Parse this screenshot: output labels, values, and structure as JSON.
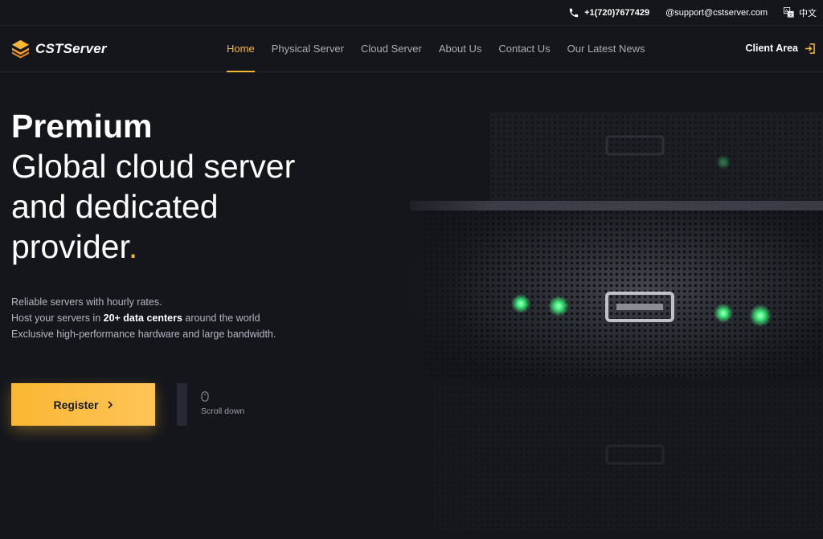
{
  "topbar": {
    "phone": "+1(720)7677429",
    "email": "@support@cstserver.com",
    "language": "中文"
  },
  "logo": {
    "text": "CSTServer"
  },
  "nav": {
    "items": [
      {
        "label": "Home"
      },
      {
        "label": "Physical Server"
      },
      {
        "label": "Cloud Server"
      },
      {
        "label": "About Us"
      },
      {
        "label": "Contact Us"
      },
      {
        "label": "Our Latest News"
      }
    ],
    "client_area": "Client Area"
  },
  "hero": {
    "premium": "Premium",
    "line1": "Global cloud server",
    "line2": "and dedicated",
    "line3": "provider",
    "dot": ".",
    "sub1": "Reliable servers with hourly rates.",
    "sub2_pre": "Host your servers in ",
    "sub2_bold": "20+ data centers",
    "sub2_post": " around the world",
    "sub3": "Exclusive high-performance hardware and large bandwidth.",
    "register": "Register",
    "scroll": "Scroll down"
  },
  "colors": {
    "accent": "#f7b733",
    "background": "#14161c",
    "led": "#3df07a"
  }
}
